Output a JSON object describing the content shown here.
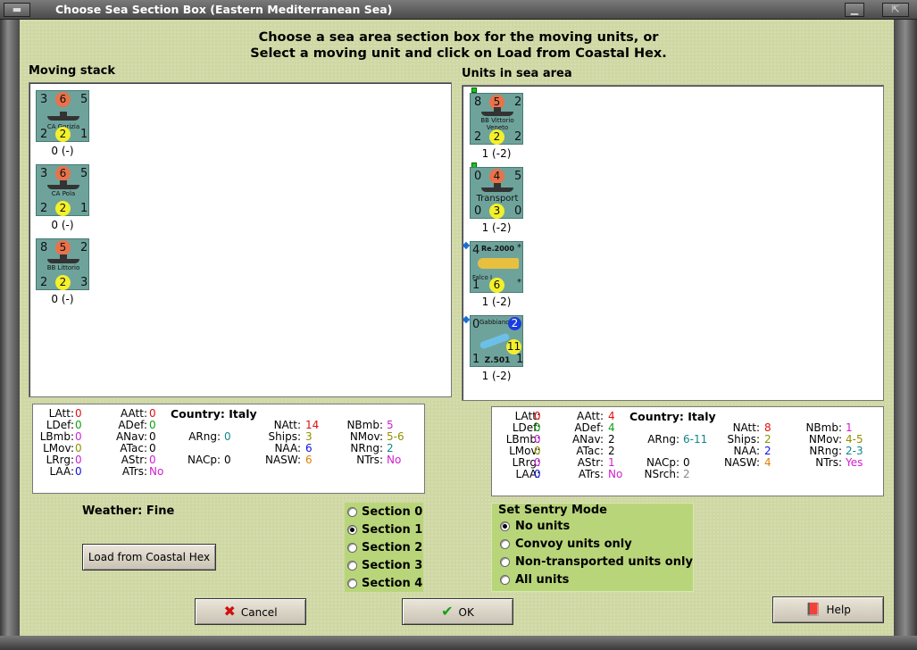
{
  "window": {
    "title": "Choose Sea Section Box (Eastern Mediterranean Sea)"
  },
  "heading": {
    "line1": "Choose a sea area section box for the moving units, or",
    "line2": "Select a moving unit and click on Load from Coastal Hex."
  },
  "moving_stack": {
    "label": "Moving stack",
    "units": [
      {
        "tl": "3",
        "tc": "6",
        "tr": "5",
        "name": "CA Gorizia",
        "bl": "2",
        "bc": "2",
        "br": "1",
        "caption": "0 (-)"
      },
      {
        "tl": "3",
        "tc": "6",
        "tr": "5",
        "name": "CA Pola",
        "bl": "2",
        "bc": "2",
        "br": "1",
        "caption": "0 (-)"
      },
      {
        "tl": "8",
        "tc": "5",
        "tr": "2",
        "name": "BB Littorio",
        "bl": "2",
        "bc": "2",
        "br": "3",
        "caption": "0 (-)"
      }
    ]
  },
  "sea_area": {
    "label": "Units in sea area",
    "units": [
      {
        "tl": "8",
        "tc": "5",
        "tr": "2",
        "name": "BB Vittorio Veneto",
        "bl": "2",
        "bc": "2",
        "br": "2",
        "caption": "1 (-2)"
      },
      {
        "tl": "0",
        "tc": "4",
        "tr": "5",
        "name": "Transport",
        "bl": "0",
        "bc": "3",
        "br": "0",
        "caption": "1 (-2)"
      },
      {
        "tl": "4",
        "tc": "Re.2000",
        "tr": "*",
        "name": "Falco I",
        "bl": "1",
        "bc": "6",
        "br": "*",
        "caption": "1 (-2)"
      },
      {
        "tl": "0",
        "tc": "Gabbiano",
        "tr": "2",
        "name": "Z.501",
        "bl": "1",
        "bc": "11",
        "br": "1",
        "caption": "1 (-2)"
      }
    ]
  },
  "stats_left": {
    "country_label": "Country: Italy",
    "LAtt": "0",
    "LDef": "0",
    "LBmb": "0",
    "LMov": "0",
    "LRrg": "0",
    "LAA": "0",
    "AAtt": "0",
    "ADef": "0",
    "ANav": "0",
    "ATac": "0",
    "AStr": "0",
    "ATrs": "No",
    "ARng": "0",
    "NACp": "0",
    "NAtt": "14",
    "Ships": "3",
    "NAA": "6",
    "NASW": "6",
    "NBmb": "5",
    "NMov": "5-6",
    "NRng": "2",
    "NTrs": "No"
  },
  "stats_right": {
    "country_label": "Country: Italy",
    "LAtt": "0",
    "LDef": "0",
    "LBmb": "0",
    "LMov": "0",
    "LRrg": "0",
    "LAA": "0",
    "AAtt": "4",
    "ADef": "4",
    "ANav": "2",
    "ATac": "2",
    "AStr": "1",
    "ATrs": "No",
    "ARng": "6-11",
    "NACp": "0",
    "NSrch": "2",
    "NAtt": "8",
    "Ships": "2",
    "NAA": "2",
    "NASW": "4",
    "NBmb": "1",
    "NMov": "4-5",
    "NRng": "2-3",
    "NTrs": "Yes"
  },
  "weather": "Weather: Fine",
  "sections": {
    "options": [
      "Section 0",
      "Section 1",
      "Section 2",
      "Section 3",
      "Section 4"
    ],
    "selected": "Section 1"
  },
  "sentry": {
    "title": "Set Sentry Mode",
    "options": [
      "No units",
      "Convoy units only",
      "Non-transported units only",
      "All units"
    ],
    "selected": "No units"
  },
  "buttons": {
    "load": "Load from Coastal Hex",
    "cancel": "Cancel",
    "ok": "OK",
    "help": "Help"
  }
}
